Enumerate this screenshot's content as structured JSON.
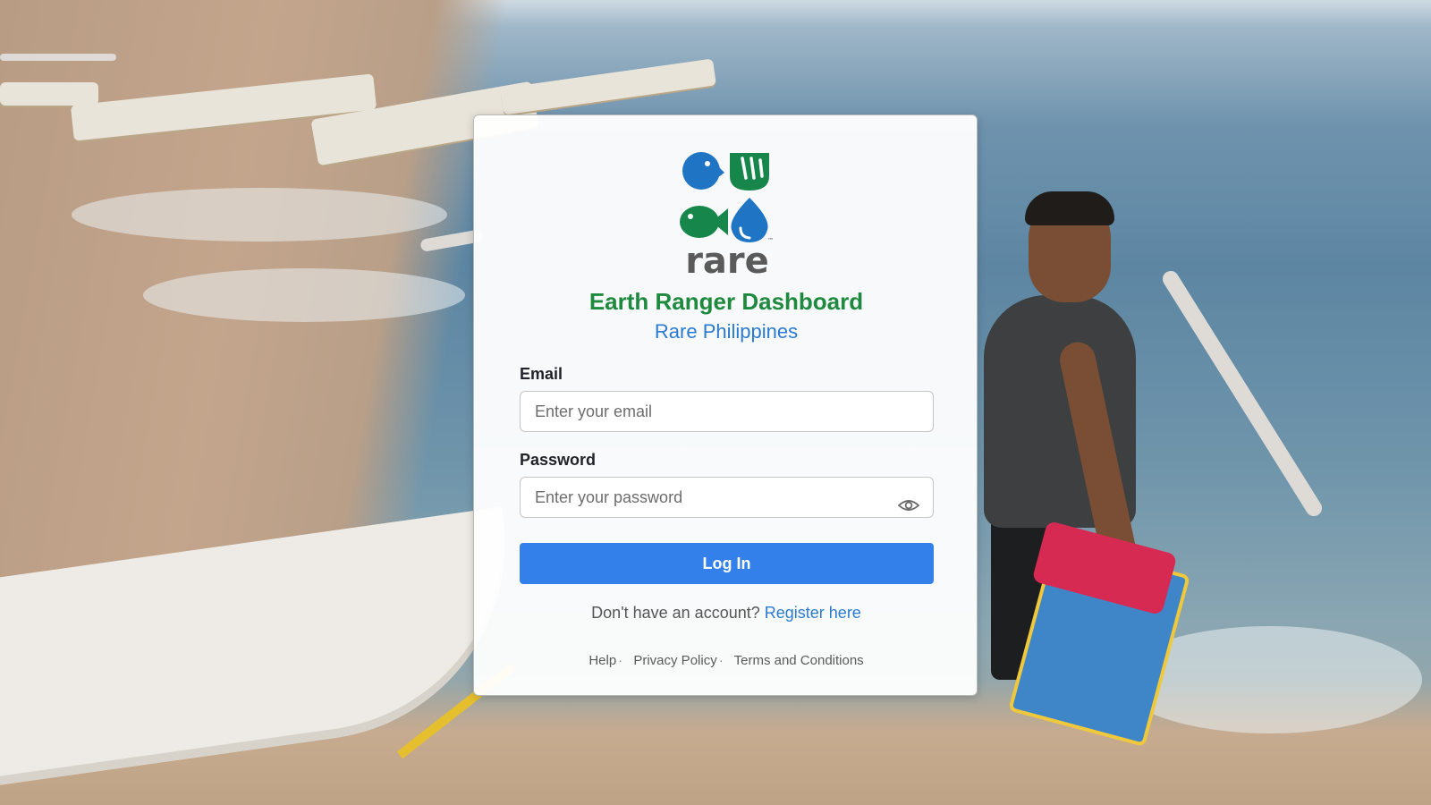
{
  "app": {
    "title": "Earth Ranger Dashboard",
    "subtitle": "Rare Philippines"
  },
  "logo": {
    "wordmark": "rare",
    "trademark": "™",
    "colors": {
      "blue": "#1f74c4",
      "green": "#17864a",
      "gray": "#5a5a5a"
    }
  },
  "form": {
    "email_label": "Email",
    "email_placeholder": "Enter your email",
    "email_value": "",
    "password_label": "Password",
    "password_placeholder": "Enter your password",
    "password_value": "",
    "password_toggle_icon": "eye-icon",
    "login_button": "Log In"
  },
  "register": {
    "prompt": "Don't have an account?",
    "link": "Register here"
  },
  "footer": {
    "links": [
      "Help",
      "Privacy Policy",
      "Terms and Conditions"
    ],
    "separator": "·"
  },
  "colors": {
    "title_green": "#1e8a3e",
    "subtitle_blue": "#2a7bd0",
    "button_blue": "#3480ea"
  }
}
